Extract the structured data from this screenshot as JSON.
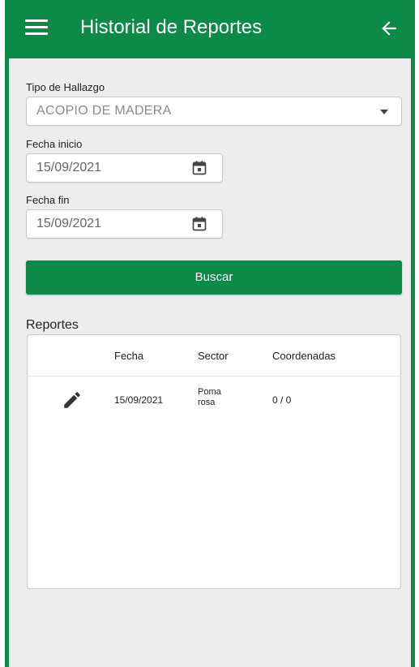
{
  "appbar": {
    "title": "Historial de Reportes",
    "menu_icon": "menu-icon",
    "back_icon": "arrow-left-icon",
    "color": "#0b8a48"
  },
  "form": {
    "tipo_label": "Tipo de Hallazgo",
    "tipo_value": "ACOPIO DE MADERA",
    "fecha_inicio_label": "Fecha inicio",
    "fecha_inicio_value": "15/09/2021",
    "fecha_fin_label": "Fecha fin",
    "fecha_fin_value": "15/09/2021",
    "calendar_icon": "calendar-icon",
    "search_label": "Buscar"
  },
  "reportes": {
    "title": "Reportes",
    "columns": [
      "Fecha",
      "Sector",
      "Coordenadas"
    ],
    "rows": [
      {
        "fecha": "15/09/2021",
        "sector_line1": "Poma",
        "sector_line2": "rosa",
        "coordenadas": "0 / 0",
        "action_icon": "pencil-icon"
      }
    ]
  }
}
